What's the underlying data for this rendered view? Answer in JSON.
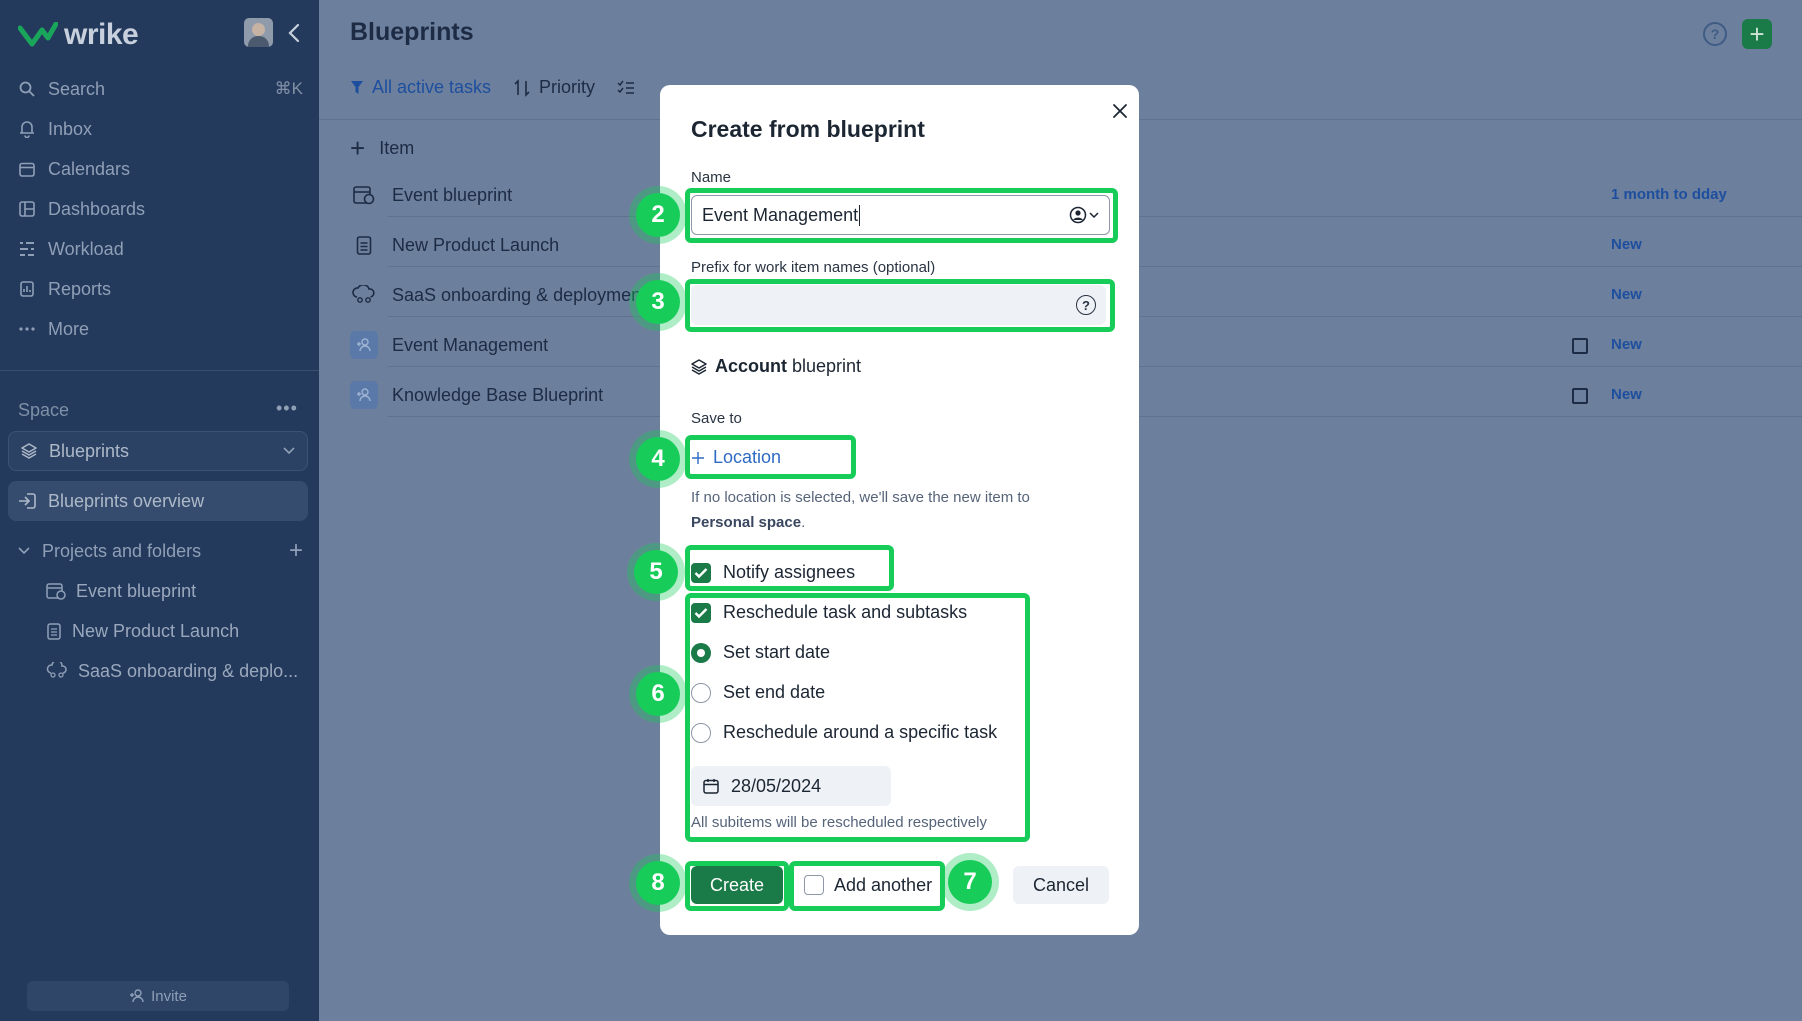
{
  "app": {
    "logo_text": "wrike",
    "colors": {
      "brand_green": "#1a7a48",
      "highlight_green": "#18cc5a",
      "link_blue": "#2f6bc4",
      "sidebar_bg": "#243a5c"
    }
  },
  "sidebar": {
    "nav": [
      {
        "label": "Search",
        "icon": "search-icon",
        "shortcut": "⌘K"
      },
      {
        "label": "Inbox",
        "icon": "bell-icon"
      },
      {
        "label": "Calendars",
        "icon": "calendar-icon"
      },
      {
        "label": "Dashboards",
        "icon": "dashboard-icon"
      },
      {
        "label": "Workload",
        "icon": "workload-icon"
      },
      {
        "label": "Reports",
        "icon": "report-icon"
      },
      {
        "label": "More",
        "icon": "more-icon"
      }
    ],
    "space_label": "Space",
    "space_selected": "Blueprints",
    "overview": "Blueprints overview",
    "projects_folders": "Projects and folders",
    "tree": [
      "Event blueprint",
      "New Product Launch",
      "SaaS onboarding & deplo..."
    ],
    "invite": "Invite"
  },
  "main": {
    "title": "Blueprints",
    "toolbar": {
      "filter": "All active tasks",
      "sort": "Priority"
    },
    "add_item": "Item",
    "rows": [
      {
        "name": "Event blueprint",
        "status": "1 month to dday"
      },
      {
        "name": "New Product Launch",
        "status": "New"
      },
      {
        "name": "SaaS onboarding & deploymen",
        "status": "New"
      },
      {
        "name": "Event Management",
        "status": "New"
      },
      {
        "name": "Knowledge Base Blueprint",
        "status": "New"
      }
    ]
  },
  "modal": {
    "title": "Create from blueprint",
    "name_label": "Name",
    "name_value": "Event Management",
    "prefix_label": "Prefix for work item names (optional)",
    "prefix_value": "",
    "account_bold": "Account",
    "account_rest": "blueprint",
    "save_to_label": "Save to",
    "location_btn": "Location",
    "hint_text": "If no location is selected, we'll save the new item to",
    "hint_bold": "Personal space",
    "hint_end": ".",
    "notify": {
      "label": "Notify assignees",
      "checked": true
    },
    "reschedule": {
      "label": "Reschedule task and subtasks",
      "checked": true
    },
    "options": [
      {
        "label": "Set start date",
        "selected": true
      },
      {
        "label": "Set end date",
        "selected": false
      },
      {
        "label": "Reschedule around a specific task",
        "selected": false
      }
    ],
    "date_value": "28/05/2024",
    "reschedule_note": "All subitems will be rescheduled respectively",
    "create_btn": "Create",
    "add_another": {
      "label": "Add another",
      "checked": false
    },
    "cancel_btn": "Cancel"
  },
  "callouts": [
    "2",
    "3",
    "4",
    "5",
    "6",
    "7",
    "8"
  ]
}
